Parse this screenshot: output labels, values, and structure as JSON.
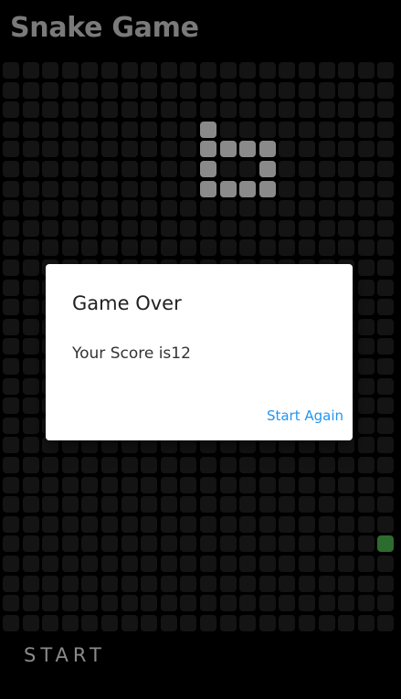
{
  "app": {
    "title": "Snake Game"
  },
  "board": {
    "columns": 20,
    "rows": 29,
    "empty_color": "#141414",
    "snake_color": "#8a8a8a",
    "food_color": "#2e6b2e",
    "snake": [
      [
        10,
        3
      ],
      [
        10,
        4
      ],
      [
        11,
        4
      ],
      [
        12,
        4
      ],
      [
        13,
        4
      ],
      [
        13,
        5
      ],
      [
        13,
        6
      ],
      [
        12,
        6
      ],
      [
        11,
        6
      ],
      [
        10,
        6
      ],
      [
        10,
        5
      ]
    ],
    "food": [
      19,
      24
    ]
  },
  "dialog": {
    "title": "Game Over",
    "message": "Your Score is12",
    "action_label": "Start Again",
    "action_color": "#2196f3"
  },
  "controls": {
    "start_label": "START"
  }
}
